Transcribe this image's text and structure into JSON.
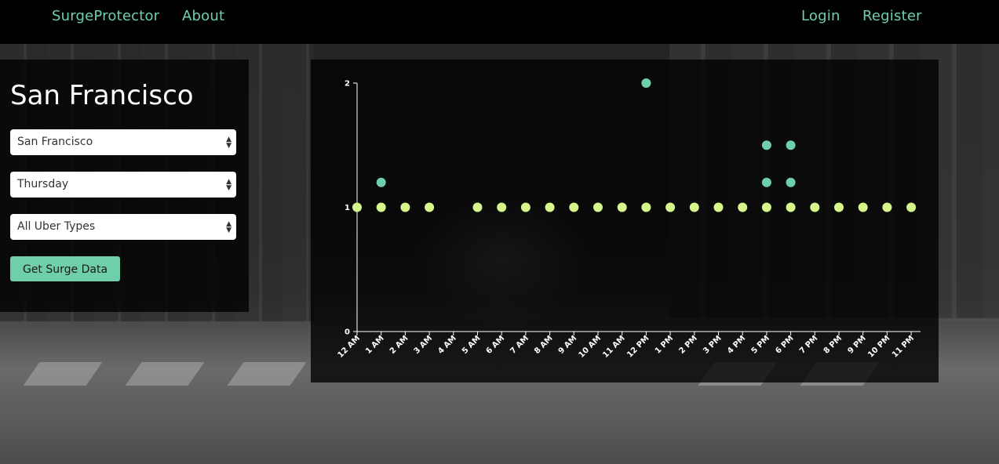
{
  "nav": {
    "brand": "SurgeProtector",
    "about": "About",
    "login": "Login",
    "register": "Register"
  },
  "sidebar": {
    "title": "San Francisco",
    "city_select": {
      "value": "San Francisco"
    },
    "day_select": {
      "value": "Thursday"
    },
    "type_select": {
      "value": "All Uber Types"
    },
    "submit_label": "Get Surge Data"
  },
  "colors": {
    "accent": "#6fcfab",
    "point_yellow": "#d6f58a",
    "point_teal": "#6fcfab"
  },
  "chart_data": {
    "type": "scatter",
    "title": "",
    "xlabel": "",
    "ylabel": "",
    "categories": [
      "12 AM",
      "1 AM",
      "2 AM",
      "3 AM",
      "4 AM",
      "5 AM",
      "6 AM",
      "7 AM",
      "8 AM",
      "9 AM",
      "10 AM",
      "11 AM",
      "12 PM",
      "1 PM",
      "2 PM",
      "3 PM",
      "4 PM",
      "5 PM",
      "6 PM",
      "7 PM",
      "8 PM",
      "9 PM",
      "10 PM",
      "11 PM"
    ],
    "yticks": [
      0,
      1,
      2
    ],
    "ylim": [
      0,
      2
    ],
    "grid": false,
    "points": [
      {
        "x": "12 AM",
        "y": 1,
        "color": "yellow"
      },
      {
        "x": "1 AM",
        "y": 1,
        "color": "yellow"
      },
      {
        "x": "1 AM",
        "y": 1.2,
        "color": "teal"
      },
      {
        "x": "2 AM",
        "y": 1,
        "color": "yellow"
      },
      {
        "x": "3 AM",
        "y": 1,
        "color": "yellow"
      },
      {
        "x": "5 AM",
        "y": 1,
        "color": "yellow"
      },
      {
        "x": "6 AM",
        "y": 1,
        "color": "yellow"
      },
      {
        "x": "7 AM",
        "y": 1,
        "color": "yellow"
      },
      {
        "x": "8 AM",
        "y": 1,
        "color": "yellow"
      },
      {
        "x": "9 AM",
        "y": 1,
        "color": "yellow"
      },
      {
        "x": "10 AM",
        "y": 1,
        "color": "yellow"
      },
      {
        "x": "11 AM",
        "y": 1,
        "color": "yellow"
      },
      {
        "x": "12 PM",
        "y": 1,
        "color": "yellow"
      },
      {
        "x": "12 PM",
        "y": 2,
        "color": "teal"
      },
      {
        "x": "1 PM",
        "y": 1,
        "color": "yellow"
      },
      {
        "x": "2 PM",
        "y": 1,
        "color": "yellow"
      },
      {
        "x": "3 PM",
        "y": 1,
        "color": "yellow"
      },
      {
        "x": "4 PM",
        "y": 1,
        "color": "yellow"
      },
      {
        "x": "5 PM",
        "y": 1,
        "color": "yellow"
      },
      {
        "x": "5 PM",
        "y": 1.2,
        "color": "teal"
      },
      {
        "x": "5 PM",
        "y": 1.5,
        "color": "teal"
      },
      {
        "x": "6 PM",
        "y": 1,
        "color": "yellow"
      },
      {
        "x": "6 PM",
        "y": 1.2,
        "color": "teal"
      },
      {
        "x": "6 PM",
        "y": 1.5,
        "color": "teal"
      },
      {
        "x": "7 PM",
        "y": 1,
        "color": "yellow"
      },
      {
        "x": "8 PM",
        "y": 1,
        "color": "yellow"
      },
      {
        "x": "9 PM",
        "y": 1,
        "color": "yellow"
      },
      {
        "x": "10 PM",
        "y": 1,
        "color": "yellow"
      },
      {
        "x": "11 PM",
        "y": 1,
        "color": "yellow"
      }
    ]
  }
}
